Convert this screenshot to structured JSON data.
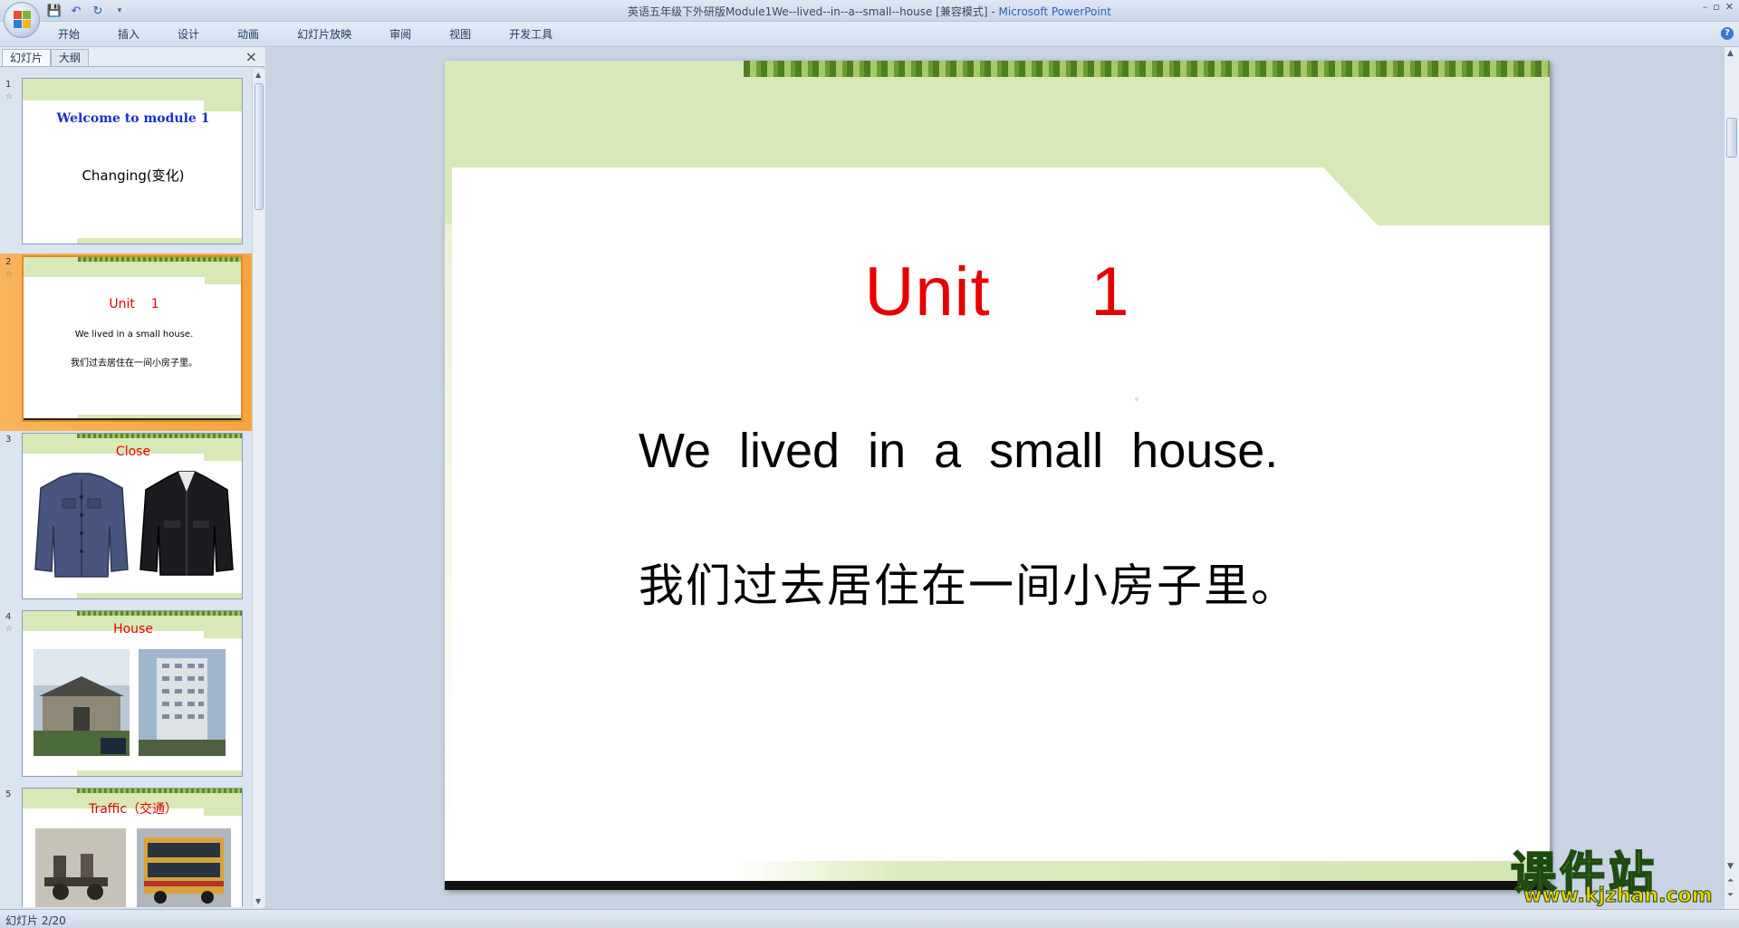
{
  "window": {
    "title": "英语五年级下外研版Module1We--lived--in--a--small--house [兼容模式]",
    "app_name": "Microsoft PowerPoint",
    "controls": [
      "–",
      "▫",
      "✕"
    ]
  },
  "ribbon": {
    "tabs": [
      "开始",
      "插入",
      "设计",
      "动画",
      "幻灯片放映",
      "审阅",
      "视图",
      "开发工具"
    ]
  },
  "left_pane": {
    "tabs": [
      "幻灯片",
      "大纲"
    ],
    "close": "×",
    "slides": [
      {
        "num": "1",
        "title": "Welcome to module 1",
        "subtitle": "Changing(变化)"
      },
      {
        "num": "2",
        "title": "Unit    1",
        "line1": "We lived in a small house.",
        "line2": "我们过去居住在一间小房子里。"
      },
      {
        "num": "3",
        "title": "Close"
      },
      {
        "num": "4",
        "title": "House"
      },
      {
        "num": "5",
        "title": "Traffic（交通）"
      }
    ]
  },
  "slide": {
    "unit": "Unit     1",
    "sentence_en": "We lived in a small house.",
    "sentence_zh": "我们过去居住在一间小房子里。"
  },
  "watermark": {
    "cn": "课件站",
    "url": "www.kjzhan.com"
  },
  "status": {
    "slide_info": "幻灯片 2/20"
  },
  "colors": {
    "slide_green": "#d9e8b8",
    "unit_red": "#e60000",
    "active_thumb": "#f7a440"
  }
}
